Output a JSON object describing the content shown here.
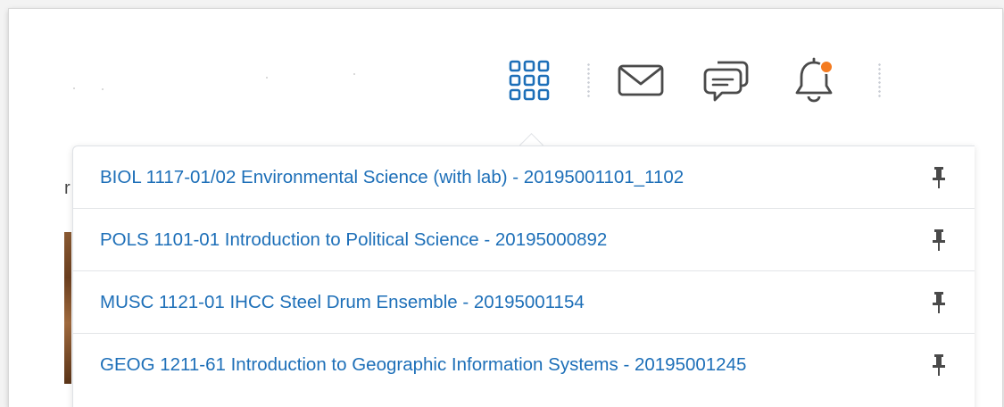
{
  "navbar": {
    "icons": [
      {
        "name": "course-selector-grid-icon",
        "active": true,
        "color": "#1d6fb8"
      },
      {
        "name": "message-alerts-icon",
        "active": false
      },
      {
        "name": "subscription-alerts-icon",
        "active": false
      },
      {
        "name": "update-alerts-bell-icon",
        "active": false,
        "has_badge": true,
        "badge_color": "#f47b20"
      }
    ]
  },
  "course_menu": {
    "items": [
      {
        "label": "BIOL 1117-01/02 Environmental Science (with lab) - 20195001101_1102",
        "pin_icon": "pin-icon"
      },
      {
        "label": "POLS 1101-01 Introduction to Political Science - 20195000892",
        "pin_icon": "pin-icon"
      },
      {
        "label": "MUSC 1121-01 IHCC Steel Drum Ensemble - 20195001154",
        "pin_icon": "pin-icon"
      },
      {
        "label": "GEOG 1211-61 Introduction to Geographic Information Systems - 20195001245",
        "pin_icon": "pin-icon"
      }
    ]
  },
  "colors": {
    "link": "#1d6fb8",
    "icon_gray": "#4a4a4a",
    "badge": "#f47b20"
  }
}
